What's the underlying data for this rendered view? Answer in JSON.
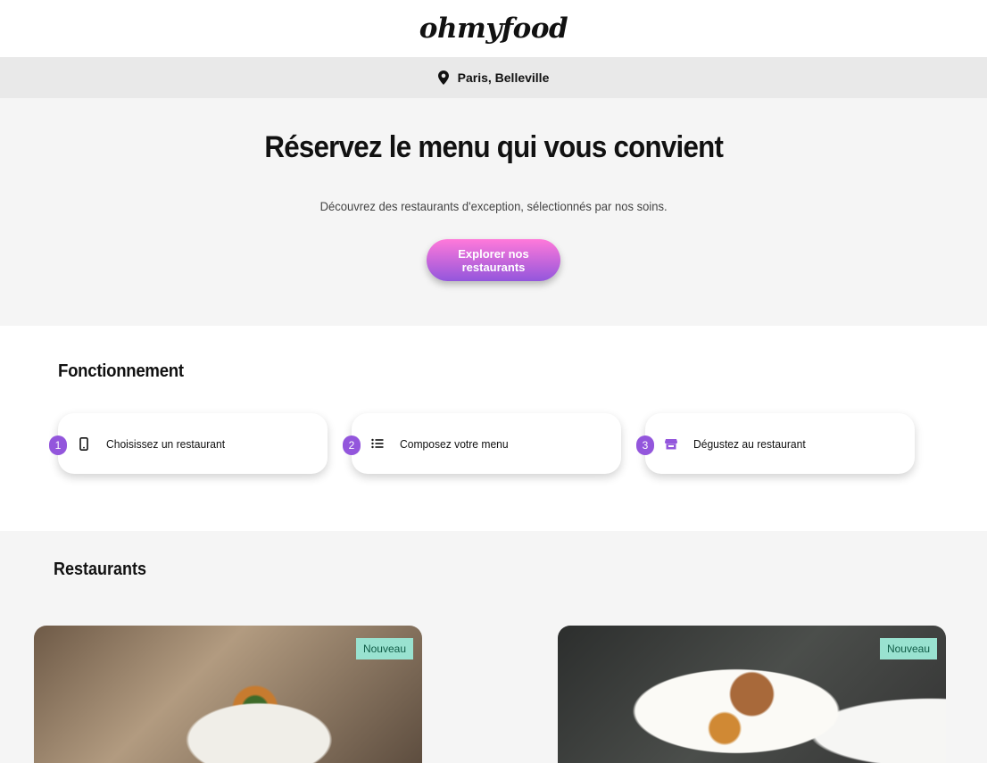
{
  "header": {
    "logo": "ohmyfood"
  },
  "location": {
    "icon": "map-pin-icon",
    "text": "Paris, Belleville"
  },
  "hero": {
    "title": "Réservez le menu qui vous convient",
    "subtitle": "Découvrez des restaurants d'exception, sélectionnés par nos soins.",
    "cta_label": "Explorer nos restaurants"
  },
  "how": {
    "title": "Fonctionnement",
    "steps": [
      {
        "number": "1",
        "icon": "smartphone-icon",
        "label": "Choisissez un restaurant"
      },
      {
        "number": "2",
        "icon": "list-icon",
        "label": "Composez votre menu"
      },
      {
        "number": "3",
        "icon": "store-icon",
        "label": "Dégustez au restaurant"
      }
    ]
  },
  "restaurants": {
    "title": "Restaurants",
    "cards": [
      {
        "badge": "Nouveau"
      },
      {
        "badge": "Nouveau"
      }
    ]
  },
  "colors": {
    "accent": "#9356dc",
    "gradient_start": "#ff79da",
    "gradient_end": "#9356dc",
    "badge_bg": "#99e2d0"
  }
}
